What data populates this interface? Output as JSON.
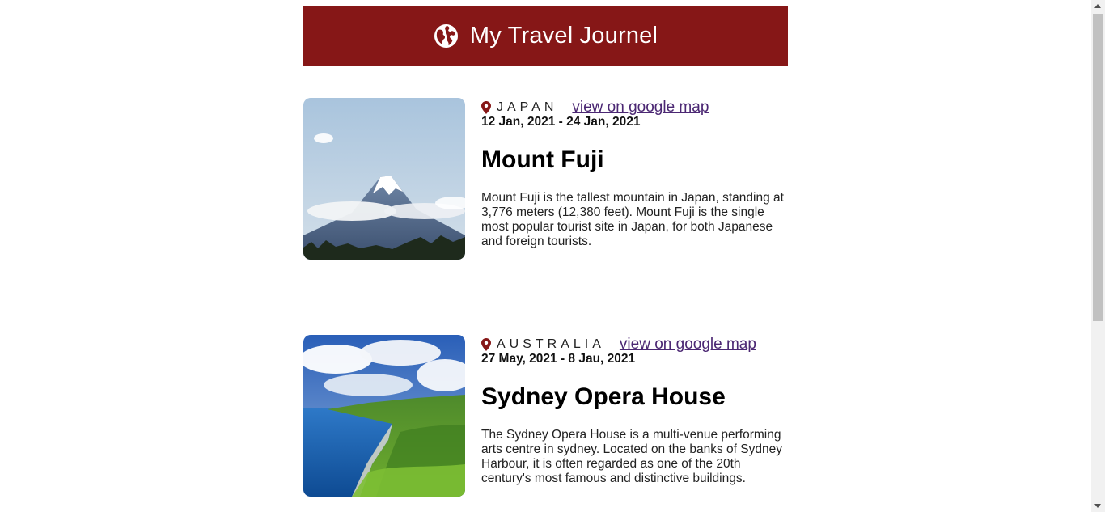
{
  "header": {
    "title": "My Travel Journel",
    "icon": "globe-icon",
    "background": "#861717"
  },
  "entries": [
    {
      "country": "JAPAN",
      "map_link_label": "view on google map",
      "dates": "12 Jan, 2021 - 24 Jan, 2021",
      "title": "Mount Fuji",
      "description": "Mount Fuji is the tallest mountain in Japan, standing at 3,776 meters (12,380 feet). Mount Fuji is the single most popular tourist site in Japan, for both Japanese and foreign tourists.",
      "image": "mount-fuji-photo"
    },
    {
      "country": "AUSTRALIA",
      "map_link_label": "view on google map",
      "dates": "27 May, 2021 - 8 Jau, 2021",
      "title": "Sydney Opera House",
      "description": "The Sydney Opera House is a multi-venue performing arts centre in sydney. Located on the banks of Sydney Harbour, it is often regarded as one of the 20th century's most famous and distinctive buildings.",
      "image": "coastline-photo"
    }
  ],
  "colors": {
    "accent": "#861717",
    "link": "#4b2773",
    "pin": "#861717"
  }
}
